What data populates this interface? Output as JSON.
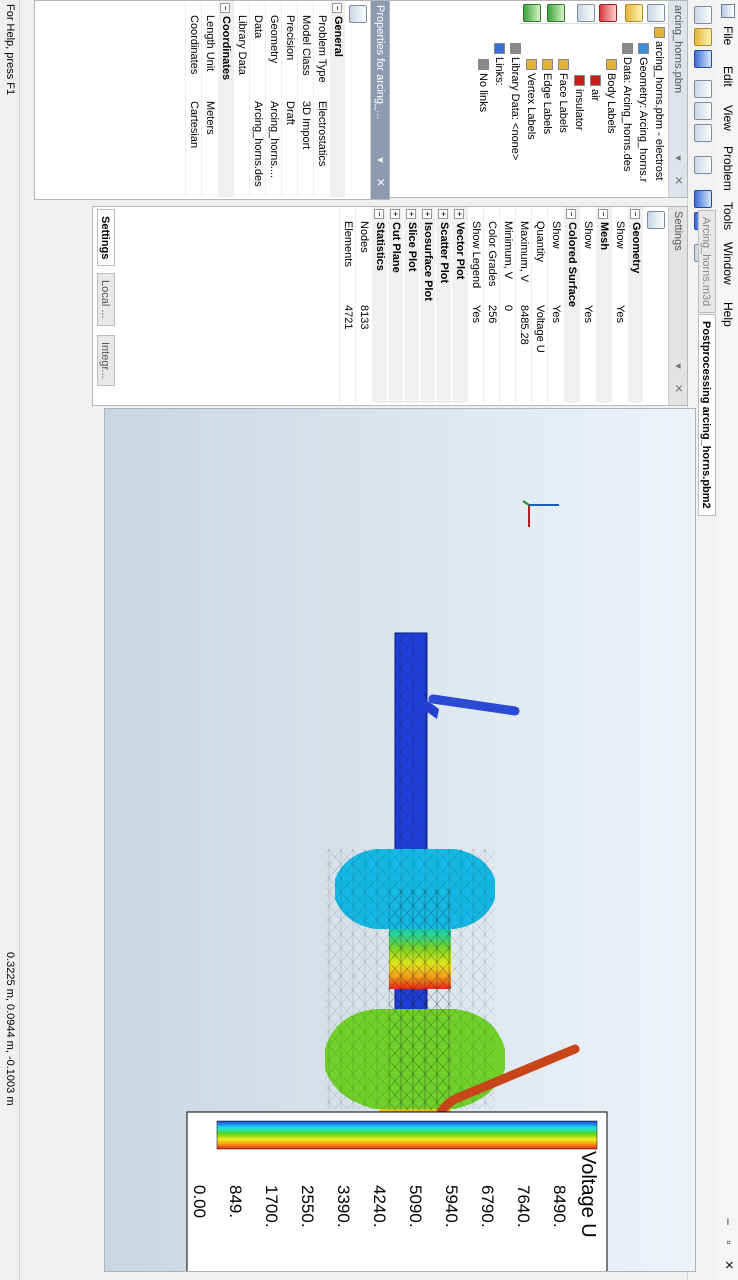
{
  "menu": [
    "File",
    "Edit",
    "View",
    "Problem",
    "Tools",
    "Window",
    "Help"
  ],
  "project_panel": {
    "title": "arcing_horns.pbm",
    "tree": [
      {
        "label": "arcing_horns.pbm - electrost",
        "level": 0
      },
      {
        "label": "Geometry: Arcing_horns.r",
        "level": 1
      },
      {
        "label": "Data: Arcing_horns.des",
        "level": 1
      },
      {
        "label": "Body Labels",
        "level": 2
      },
      {
        "label": "air",
        "level": 3
      },
      {
        "label": "insulator",
        "level": 3
      },
      {
        "label": "Face Labels",
        "level": 2
      },
      {
        "label": "Edge Labels",
        "level": 2
      },
      {
        "label": "Vertex Labels",
        "level": 2
      },
      {
        "label": "Library Data: <none>",
        "level": 1
      },
      {
        "label": "Links:",
        "level": 1
      },
      {
        "label": "No links",
        "level": 2
      }
    ]
  },
  "properties_panel": {
    "title": "Properties for arcing_...",
    "groups": [
      {
        "name": "General",
        "rows": [
          {
            "key": "Problem Type",
            "value": "Electrostatics"
          },
          {
            "key": "Model Class",
            "value": "3D Import"
          },
          {
            "key": "Precision",
            "value": "Draft"
          },
          {
            "key": "Geometry",
            "value": "Arcing_horns...."
          },
          {
            "key": "Data",
            "value": "Arcing_horns.des"
          },
          {
            "key": "Library Data",
            "value": ""
          }
        ]
      },
      {
        "name": "Coordinates",
        "rows": [
          {
            "key": "Length Unit",
            "value": "Meters"
          },
          {
            "key": "Coordinates",
            "value": "Cartesian"
          }
        ]
      }
    ]
  },
  "settings_panel": {
    "title": "Settings",
    "groups": [
      {
        "name": "Geometry",
        "rows": [
          {
            "key": "Show",
            "value": "Yes"
          }
        ]
      },
      {
        "name": "Mesh",
        "rows": [
          {
            "key": "Show",
            "value": "Yes"
          }
        ]
      },
      {
        "name": "Colored Surface",
        "rows": [
          {
            "key": "Show",
            "value": "Yes"
          },
          {
            "key": "Quantity",
            "value": "Voltage U"
          },
          {
            "key": "Maximum, V",
            "value": "8485.28"
          },
          {
            "key": "Minimum, V",
            "value": "0"
          },
          {
            "key": "Color Grades",
            "value": "256"
          },
          {
            "key": "Show Legend",
            "value": "Yes"
          }
        ]
      },
      {
        "name": "Vector Plot",
        "rows": []
      },
      {
        "name": "Scatter Plot",
        "rows": []
      },
      {
        "name": "Isosurface Plot",
        "rows": []
      },
      {
        "name": "Slice Plot",
        "rows": []
      },
      {
        "name": "Cut Plane",
        "rows": []
      },
      {
        "name": "Statistics",
        "rows": [
          {
            "key": "Nodes",
            "value": "8133"
          },
          {
            "key": "Elements",
            "value": "4721"
          }
        ]
      }
    ],
    "tabs": [
      "Settings",
      "Local ...",
      "Integr..."
    ]
  },
  "doc_tabs": [
    "Arcing_horns.m3d",
    "Postprocessing arcing_horns.pbm2"
  ],
  "legend": {
    "title": "Voltage U",
    "labels": [
      "8490.",
      "7640.",
      "6790.",
      "5940.",
      "5090.",
      "4240.",
      "3390.",
      "2550.",
      "1700.",
      "849.",
      "0.00"
    ]
  },
  "status": {
    "help": "For Help, press F1",
    "coords": "0.3225 m, 0.0944 m, -0.1003 m"
  }
}
